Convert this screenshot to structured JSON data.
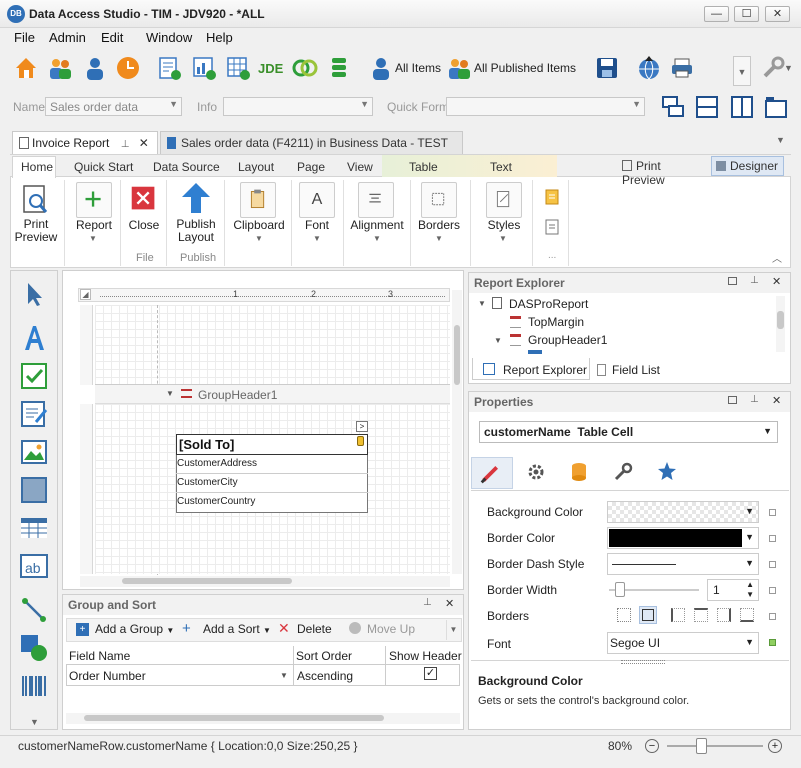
{
  "window": {
    "title": "Data Access Studio - TIM - JDV920 - *ALL",
    "logo_text": "DB",
    "minimize": "—",
    "maximize": "☐",
    "close": "✕"
  },
  "menu": [
    "File",
    "Admin",
    "Edit",
    "Window",
    "Help"
  ],
  "toolbar": {
    "all_items": "All Items",
    "all_published_items": "All Published Items",
    "jde_label": "JDE"
  },
  "filter": {
    "name_label": "Name",
    "name_value": "Sales order data",
    "info_label": "Info",
    "info_value": "",
    "quick_form_label": "Quick Form",
    "quick_form_value": ""
  },
  "doc_tabs": [
    {
      "label": "Invoice Report",
      "active": true
    },
    {
      "label": "Sales order data (F4211) in Business Data - TEST",
      "active": false
    }
  ],
  "ribbon": {
    "tabs": [
      "Home",
      "Quick Start",
      "Data Source",
      "Layout",
      "Page",
      "View",
      "Table",
      "Text"
    ],
    "print_preview_tab": "Print Preview",
    "designer_tab": "Designer",
    "buttons": {
      "print_preview": [
        "Print",
        "Preview"
      ],
      "report": "Report",
      "close": "Close",
      "publish_layout": [
        "Publish",
        "Layout"
      ],
      "clipboard": "Clipboard",
      "font": "Font",
      "alignment": "Alignment",
      "borders": "Borders",
      "styles": "Styles"
    },
    "groups": {
      "file": "File",
      "publish": "Publish"
    }
  },
  "designer": {
    "ruler_marks": [
      "1",
      "2",
      "3"
    ],
    "band_groupheader": "GroupHeader1",
    "table_cells": [
      "[Sold To]",
      "CustomerAddress",
      "CustomerCity",
      "CustomerCountry"
    ],
    "smart_tag": ">"
  },
  "group_sort": {
    "title": "Group and Sort",
    "add_group": "Add a Group",
    "add_sort": "Add a Sort",
    "delete": "Delete",
    "move_up": "Move Up",
    "columns": [
      "Field Name",
      "Sort Order",
      "Show Header"
    ],
    "rows": [
      {
        "field": "Order Number",
        "sort": "Ascending",
        "show_header": true
      }
    ]
  },
  "report_explorer": {
    "title": "Report Explorer",
    "items": [
      "DASProReport",
      "TopMargin",
      "GroupHeader1"
    ],
    "tab_explorer": "Report Explorer",
    "tab_field_list": "Field List"
  },
  "properties": {
    "title": "Properties",
    "selected_object": "customerName",
    "selected_type": "Table Cell",
    "rows": [
      {
        "label": "Background Color",
        "value": ""
      },
      {
        "label": "Border Color",
        "value": ""
      },
      {
        "label": "Border Dash Style",
        "value": ""
      },
      {
        "label": "Border Width",
        "value": "1"
      },
      {
        "label": "Borders",
        "value": ""
      },
      {
        "label": "Font",
        "value": "Segoe UI"
      }
    ],
    "help_title": "Background Color",
    "help_text": "Gets or sets the control's background color."
  },
  "status": {
    "text": "customerNameRow.customerName { Location:0,0 Size:250,25 }",
    "zoom": "80%"
  },
  "colors": {
    "accent": "#2f6fb6",
    "close_red": "#d9363e",
    "add_green": "#2e9e3a",
    "orange": "#f0a030"
  }
}
